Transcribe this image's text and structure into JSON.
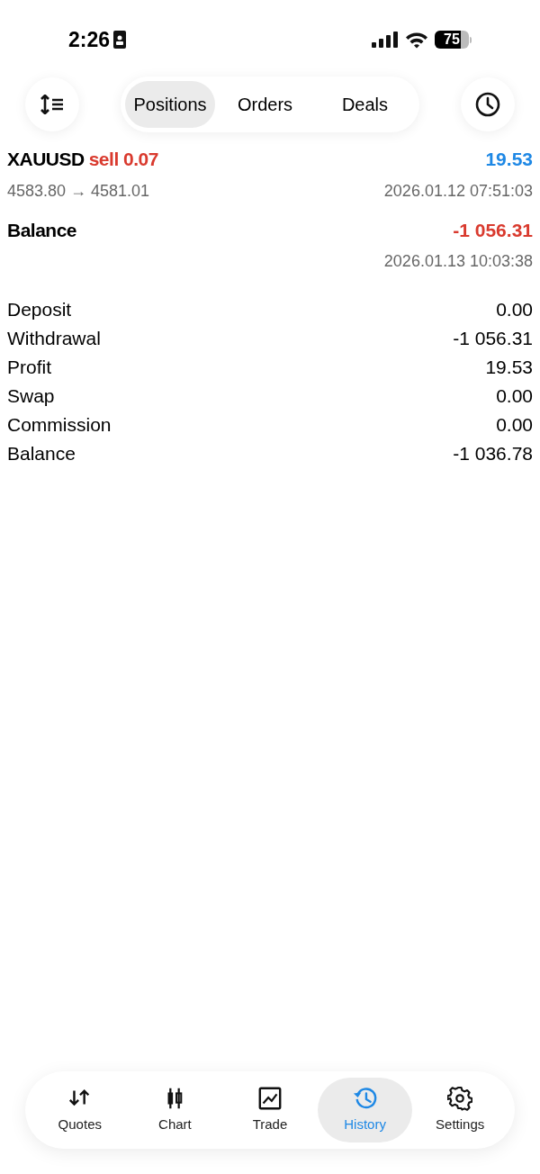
{
  "status_bar": {
    "time": "2:26",
    "battery": "75"
  },
  "segments": [
    {
      "label": "Positions",
      "selected": true
    },
    {
      "label": "Orders",
      "selected": false
    },
    {
      "label": "Deals",
      "selected": false
    }
  ],
  "deals": [
    {
      "symbol": "XAUUSD",
      "action": "sell 0.07",
      "amount": "19.53",
      "color": "#1e88e5",
      "prices": "4583.80 → 4581.01",
      "time": "2026.01.12 07:51:03"
    },
    {
      "symbol": "Balance",
      "amount": "-1 056.31",
      "color": "#d93a2e",
      "time": "2026.01.13 10:03:38"
    }
  ],
  "summary": [
    {
      "label": "Deposit",
      "value": "0.00"
    },
    {
      "label": "Withdrawal",
      "value": "-1 056.31"
    },
    {
      "label": "Profit",
      "value": "19.53"
    },
    {
      "label": "Swap",
      "value": "0.00"
    },
    {
      "label": "Commission",
      "value": "0.00"
    },
    {
      "label": "Balance",
      "value": "-1 036.78"
    }
  ],
  "tab_bar": [
    {
      "label": "Quotes",
      "kind": "quotes",
      "selected": false
    },
    {
      "label": "Chart",
      "kind": "chart",
      "selected": false
    },
    {
      "label": "Trade",
      "kind": "trade",
      "selected": false
    },
    {
      "label": "History",
      "kind": "history",
      "selected": true
    },
    {
      "label": "Settings",
      "kind": "settings",
      "selected": false
    }
  ]
}
